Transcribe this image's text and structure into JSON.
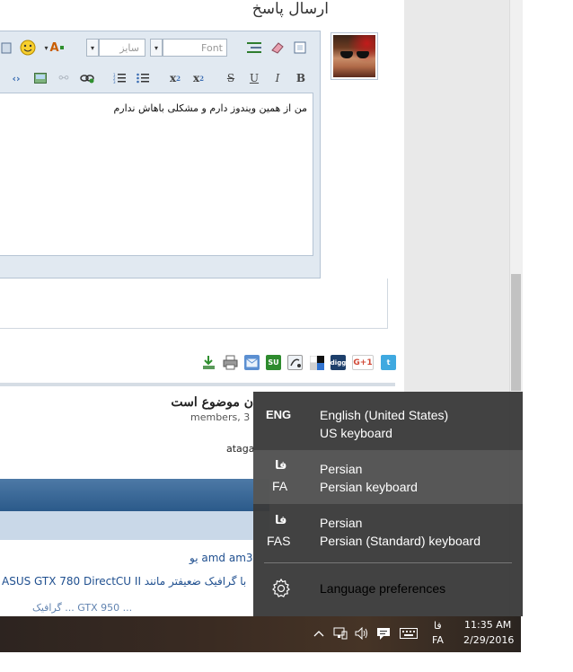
{
  "reply": {
    "title": "ارسال پاسخ",
    "editor_text": "من از همین ویندوز دارم و مشکلی باهاش ندارم",
    "font_select": "Font",
    "size_select": "سایز"
  },
  "thread": {
    "title": "ن موضوع است",
    "subtitle": "members, 3",
    "user": "ataga"
  },
  "links": {
    "l1": "amd am3 یو",
    "l2": "ASUS GTX 780 DirectCU II با گرافیک ضعیفتر مانند",
    "l3": "گرافیک ... GTX 950 ..."
  },
  "language_flyout": {
    "items": [
      {
        "code": "ENG",
        "name": "English (United States)",
        "keyboard": "US keyboard"
      },
      {
        "code_top": "فا",
        "code": "FA",
        "name": "Persian",
        "keyboard": "Persian keyboard"
      },
      {
        "code_top": "فا",
        "code": "FAS",
        "name": "Persian",
        "keyboard": "Persian (Standard) keyboard"
      }
    ],
    "preferences_label": "Language preferences"
  },
  "taskbar": {
    "lang_top": "فا",
    "lang_bottom": "FA",
    "time": "11:35 AM",
    "date": "2/29/2016"
  },
  "icons": {
    "prefs": "gear-icon",
    "share": [
      "download-icon",
      "print-icon",
      "email-icon",
      "stumbleupon-icon",
      "share-icon",
      "delicious-icon",
      "digg-icon",
      "googleplus-icon",
      "twitter-icon"
    ]
  },
  "colors": {
    "flyout_bg": "#3a3a3a",
    "flyout_selected": "#5a5a5a",
    "link": "#1f4f8f"
  }
}
